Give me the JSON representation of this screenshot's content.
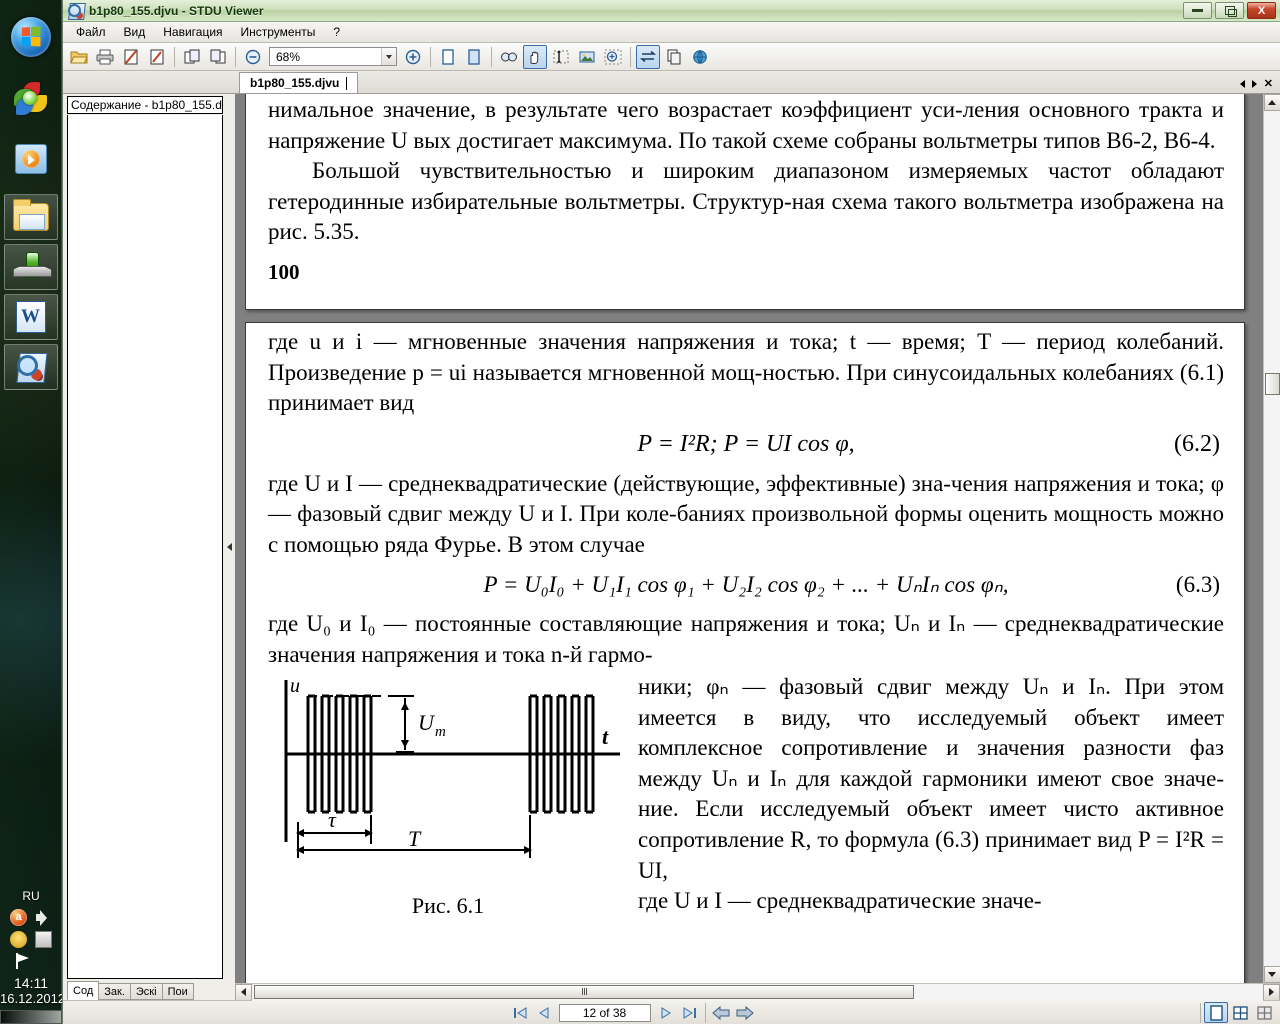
{
  "desktop": {
    "taskbar_icons": [
      {
        "name": "start-orb",
        "label": "Пуск"
      },
      {
        "name": "browser-icon",
        "label": "Браузер"
      },
      {
        "name": "media-player-icon",
        "label": "Проигрыватель"
      },
      {
        "name": "explorer-icon",
        "label": "Проводник"
      },
      {
        "name": "green-app-icon",
        "label": "Приложение"
      },
      {
        "name": "word-icon",
        "label": "W"
      },
      {
        "name": "stdu-viewer-icon",
        "label": "STDU Viewer"
      }
    ],
    "tray": {
      "language": "RU",
      "icons": [
        "antivirus-icon",
        "volume-icon",
        "network-icon",
        "display-icon",
        "flag-icon"
      ],
      "clock": "14:11",
      "date": "16.12.2012"
    }
  },
  "window": {
    "title": "b1p80_155.djvu - STDU Viewer",
    "buttons": {
      "minimize": "minimize",
      "restore": "restore",
      "close": "X"
    }
  },
  "menu": [
    {
      "label": "Файл",
      "accel": "Ф"
    },
    {
      "label": "Вид",
      "accel": "В"
    },
    {
      "label": "Навигация",
      "accel": "Н"
    },
    {
      "label": "Инструменты",
      "accel": "И"
    },
    {
      "label": "?",
      "accel": "?"
    }
  ],
  "toolbar": {
    "zoom_value": "68%",
    "buttons": [
      {
        "name": "open-folder-icon",
        "title": "Открыть"
      },
      {
        "name": "print-icon",
        "title": "Печать"
      },
      {
        "name": "edit-page-icon",
        "title": "Правка"
      },
      {
        "name": "edit-page2-icon",
        "title": "Правка 2"
      },
      {
        "name": "prev-doc-icon",
        "title": "Предыдущий документ"
      },
      {
        "name": "next-doc-icon",
        "title": "Следующий документ"
      },
      {
        "name": "zoom-out-icon",
        "title": "Уменьшить"
      },
      {
        "name": "zoom-in-icon",
        "title": "Увеличить"
      },
      {
        "name": "single-page-icon",
        "title": "Одна страница"
      },
      {
        "name": "facing-page-icon",
        "title": "Разворот"
      },
      {
        "name": "find-icon",
        "title": "Поиск"
      },
      {
        "name": "hand-tool-icon",
        "title": "Рука"
      },
      {
        "name": "text-select-icon",
        "title": "Выделение текста"
      },
      {
        "name": "image-select-icon",
        "title": "Выделение изображения"
      },
      {
        "name": "zoom-select-icon",
        "title": "Масштаб области"
      },
      {
        "name": "fit-width-icon",
        "title": "По ширине"
      },
      {
        "name": "copy-icon",
        "title": "Копировать"
      },
      {
        "name": "globe-icon",
        "title": "Ссылка"
      }
    ]
  },
  "tabstrip": {
    "tabs": [
      {
        "label": "b1p80_155.djvu",
        "active": true
      }
    ],
    "controls": [
      "scroll-left",
      "scroll-right",
      "close-tab"
    ]
  },
  "sidebar": {
    "header": "Содержание - b1p80_155.d",
    "items": [],
    "tabs": [
      {
        "label": "Сод",
        "active": true
      },
      {
        "label": "Зак.",
        "active": false
      },
      {
        "label": "Эскі",
        "active": false
      },
      {
        "label": "Пои",
        "active": false
      }
    ]
  },
  "document": {
    "prev_page": {
      "paragraphs": [
        "нимальное значение, в результате чего возрастает коэффициент уси-ления основного тракта и напряжение U вых достигает максимума. По такой схеме собраны вольтметры типов В6-2, В6-4.",
        "Большой чувствительностью и широким диапазоном измеряемых частот обладают гетеродинные избирательные вольтметры. Структур-ная схема такого вольтметра изображена на рис. 5.35."
      ],
      "page_number": "100"
    },
    "current_page": {
      "p1": "где u и i — мгновенные значения напряжения и тока; t — время; T — период колебаний. Произведение p = ui называется мгновенной мощ-ностью. При синусоидальных колебаниях (6.1) принимает вид",
      "eq1": "P = I²R;  P = UI cos φ,",
      "eq1_no": "(6.2)",
      "p2": "где U и I — среднеквадратические (действующие, эффективные) зна-чения напряжения и тока; φ — фазовый сдвиг между U и I. При коле-баниях произвольной формы оценить мощность можно с помощью ряда Фурье. В этом случае",
      "eq2": "P = U₀I₀ + U₁I₁ cos φ₁ + U₂I₂ cos φ₂ + ... + UₙIₙ cos φₙ,",
      "eq2_no": "(6.3)",
      "p3": "где U₀ и I₀ — постоянные составляющие напряжения и тока; Uₙ и Iₙ — среднеквадратические значения напряжения и тока n-й гармо-",
      "p4": "ники; φₙ — фазовый сдвиг между Uₙ и Iₙ. При этом имеется в виду, что исследуемый объект имеет комплексное сопротивление и значения разности фаз между Uₙ и Iₙ для каждой гармоники имеют свое значе-ние. Если исследуемый объект имеет чисто активное сопротивление R, то формула (6.3) принимает вид P = I²R = UI,",
      "p5": "где U и I — среднеквадратические значе-",
      "figure": {
        "caption": "Рис. 6.1",
        "y_axis_label": "u",
        "x_axis_label": "t",
        "amplitude_label": "Uₘ",
        "pulse_width_label": "τ",
        "period_label": "T"
      }
    }
  },
  "statusbar": {
    "page_indicator": "12 of 38",
    "nav": [
      "first-page",
      "prev-page",
      "next-page",
      "last-page",
      "back",
      "forward"
    ],
    "view_modes": [
      {
        "name": "single-page-view",
        "active": true
      },
      {
        "name": "four-page-view",
        "active": false
      },
      {
        "name": "continuous-view",
        "active": false
      }
    ]
  },
  "colors": {
    "accent": "#3a6ea5",
    "close_red": "#c8452a",
    "title_green": "#cfe0bd",
    "page_bg": "#ffffff",
    "viewer_bg": "#808080"
  }
}
